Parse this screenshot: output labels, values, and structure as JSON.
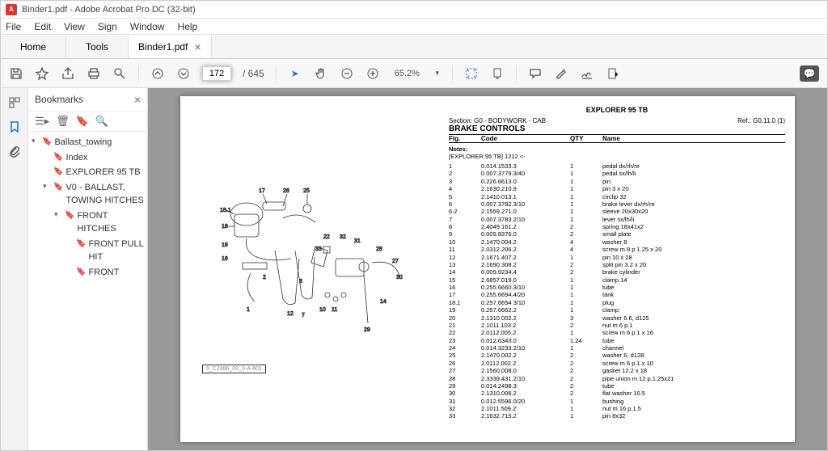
{
  "titlebar": {
    "text": "Binder1.pdf - Adobe Acrobat Pro DC (32-bit)"
  },
  "menubar": [
    "File",
    "Edit",
    "View",
    "Sign",
    "Window",
    "Help"
  ],
  "tabs": {
    "home": "Home",
    "tools": "Tools",
    "doc": "Binder1.pdf"
  },
  "toolbar": {
    "page_current": "172",
    "page_total": "645",
    "zoom": "65.2%"
  },
  "bookmarks": {
    "title": "Bookmarks",
    "items": [
      {
        "label": "Ballast_towing",
        "expanded": true,
        "children": [
          {
            "label": "Index"
          },
          {
            "label": "EXPLORER 95 TB"
          },
          {
            "label": "V0 - BALLAST, TOWING HITCHES",
            "expanded": true,
            "children": [
              {
                "label": "FRONT HITCHES",
                "expanded": true,
                "children": [
                  {
                    "label": "FRONT PULL HIT"
                  },
                  {
                    "label": "FRONT"
                  }
                ]
              }
            ]
          }
        ]
      }
    ]
  },
  "doc": {
    "model": "EXPLORER 95 TB",
    "section": "Section: G0 - BODYWORK - CAB",
    "ref": "Ref.: G0.11.0 (1)",
    "title": "BRAKE CONTROLS",
    "cols": {
      "c1": "Fig.",
      "c2": "Code",
      "c3": "QTY",
      "c4": "Name"
    },
    "notes_label": "Notes:",
    "notes_line": "[EXPLORER 95 TB] 1212 <-",
    "diagram_caption": "9_C2386_00_0-A-601",
    "parts": [
      {
        "f": "1",
        "c": "0.014.1533.3",
        "q": "1",
        "n": "pedal dx/rh/re"
      },
      {
        "f": "2",
        "c": "0.007.3779.3/40",
        "q": "1",
        "n": "pedal sx/lh/li"
      },
      {
        "f": "3",
        "c": "0.226.6613.0",
        "q": "1",
        "n": "pin"
      },
      {
        "f": "4",
        "c": "2.1630.210.9",
        "q": "1",
        "n": "pin 3 x 20"
      },
      {
        "f": "5",
        "c": "2.1410.013.1",
        "q": "1",
        "n": "circlip 32"
      },
      {
        "f": "6",
        "c": "0.007.3782.3/10",
        "q": "1",
        "n": "brake lever dx/rh/re"
      },
      {
        "f": "6.2",
        "c": "2.1559.271.0",
        "q": "1",
        "n": "sleeve 20x30x20"
      },
      {
        "f": "7",
        "c": "0.007.3783.2/10",
        "q": "1",
        "n": "lever sx/lh/li"
      },
      {
        "f": "8",
        "c": "2.4049.161.2",
        "q": "2",
        "n": "spring 18x41x2"
      },
      {
        "f": "9",
        "c": "0.009.8376.0",
        "q": "2",
        "n": "small plate"
      },
      {
        "f": "10",
        "c": "2.1470.004.2",
        "q": "4",
        "n": "washer 8"
      },
      {
        "f": "11",
        "c": "2.0312.206.2",
        "q": "4",
        "n": "screw m 8 p 1.25 x 20"
      },
      {
        "f": "12",
        "c": "2.1671.407.2",
        "q": "1",
        "n": "pin 10 x 28"
      },
      {
        "f": "13",
        "c": "2.1690.308.2",
        "q": "2",
        "n": "split pin 3.2 x 20"
      },
      {
        "f": "14",
        "c": "0.009.9234.4",
        "q": "2",
        "n": "brake cylinder"
      },
      {
        "f": "15",
        "c": "2.6857.019.0",
        "q": "1",
        "n": "clamp 14"
      },
      {
        "f": "16",
        "c": "0.255.6660.3/10",
        "q": "1",
        "n": "tube"
      },
      {
        "f": "17",
        "c": "0.255.6694.4/20",
        "q": "1",
        "n": "tank"
      },
      {
        "f": "18.1",
        "c": "0.257.6654 3/10",
        "q": "1",
        "n": "plug"
      },
      {
        "f": "19",
        "c": "0.257.6662.2",
        "q": "1",
        "n": "clamp"
      },
      {
        "f": "20",
        "c": "2.1310.002.2",
        "q": "3",
        "n": "washer 6.6, d125"
      },
      {
        "f": "21",
        "c": "2.1011.103.2",
        "q": "2",
        "n": "nut m 6 p.1"
      },
      {
        "f": "22",
        "c": "2.0112.005.2",
        "q": "1",
        "n": "screw m 6 p.1 x 16"
      },
      {
        "f": "23",
        "c": "0.012.6343.0",
        "q": "1.24",
        "n": "tube"
      },
      {
        "f": "24",
        "c": "0.014.3233.2/10",
        "q": "1",
        "n": "channel"
      },
      {
        "f": "25",
        "c": "2.1470.002.2",
        "q": "2",
        "n": "washer 6, d128"
      },
      {
        "f": "26",
        "c": "2.0112.002.2",
        "q": "2",
        "n": "screw m 6 p.1 x 10"
      },
      {
        "f": "27",
        "c": "2.1560.008.0",
        "q": "2",
        "n": "gasket 12.2 x 18"
      },
      {
        "f": "28",
        "c": "2.3339.431.2/10",
        "q": "2",
        "n": "pipe union m 12 p.1.25x21"
      },
      {
        "f": "29",
        "c": "0.014.2498.3",
        "q": "2",
        "n": "tube"
      },
      {
        "f": "30",
        "c": "2.1310.006.2",
        "q": "2",
        "n": "flat washer 10.5"
      },
      {
        "f": "31",
        "c": "0.012.5596.0/20",
        "q": "1",
        "n": "bushing"
      },
      {
        "f": "32",
        "c": "2.1011.509.2",
        "q": "1",
        "n": "nut m 16 p.1.5"
      },
      {
        "f": "33",
        "c": "2.1632.715.2",
        "q": "1",
        "n": "pin 8x32"
      }
    ]
  }
}
